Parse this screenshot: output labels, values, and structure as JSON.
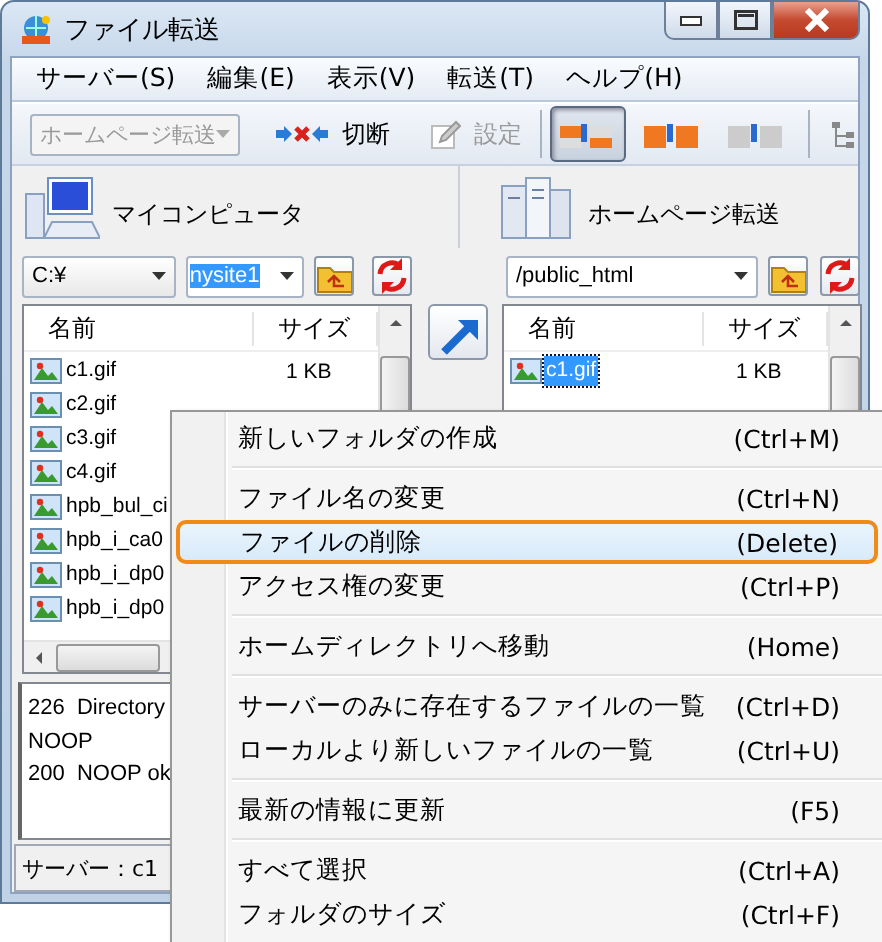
{
  "window": {
    "title": "ファイル転送"
  },
  "menu_bar": [
    {
      "label": "サーバー(S)"
    },
    {
      "label": "編集(E)"
    },
    {
      "label": "表示(V)"
    },
    {
      "label": "転送(T)"
    },
    {
      "label": "ヘルプ(H)"
    }
  ],
  "toolbar": {
    "site_select": {
      "value": "ホームページ転送",
      "disabled": true
    },
    "buttons": [
      {
        "kind": "disconnect",
        "label": "切断",
        "disabled": false
      },
      {
        "kind": "settings",
        "label": "設定",
        "disabled": true
      }
    ],
    "view_modes": [
      {
        "kind": "mixed",
        "selected": true
      },
      {
        "kind": "binary",
        "selected": false
      },
      {
        "kind": "text",
        "selected": false
      }
    ]
  },
  "local_pane": {
    "title": "マイコンピュータ",
    "drive": "C:¥",
    "folder": {
      "value": "nysite1",
      "selected": true
    },
    "columns": [
      "名前",
      "サイズ"
    ],
    "files": [
      {
        "name": "c1.gif",
        "size": "1 KB",
        "selected": false
      },
      {
        "name": "c2.gif",
        "selected": false
      },
      {
        "name": "c3.gif",
        "selected": false
      },
      {
        "name": "c4.gif",
        "selected": false
      },
      {
        "name": "hpb_bul_ci",
        "selected": false
      },
      {
        "name": "hpb_i_ca0",
        "selected": false
      },
      {
        "name": "hpb_i_dp0",
        "selected": false
      },
      {
        "name": "hpb_i_dp0",
        "selected": false
      }
    ]
  },
  "remote_pane": {
    "title": "ホームページ転送",
    "path": "/public_html",
    "columns": [
      "名前",
      "サイズ"
    ],
    "files": [
      {
        "name": "c1.gif",
        "size": "1 KB",
        "selected": true
      }
    ]
  },
  "log": [
    "226  Directory",
    "NOOP",
    "200  NOOP ok"
  ],
  "status_bar": "サーバー：c1",
  "context_menu": [
    {
      "kind": "item",
      "label": "新しいフォルダの作成",
      "shortcut": "(Ctrl+M)",
      "selected": false
    },
    {
      "kind": "separator"
    },
    {
      "kind": "item",
      "label": "ファイル名の変更",
      "shortcut": "(Ctrl+N)",
      "selected": false
    },
    {
      "kind": "item",
      "label": "ファイルの削除",
      "shortcut": "(Delete)",
      "selected": true
    },
    {
      "kind": "item",
      "label": "アクセス権の変更",
      "shortcut": "(Ctrl+P)",
      "selected": false
    },
    {
      "kind": "separator"
    },
    {
      "kind": "item",
      "label": "ホームディレクトリへ移動",
      "shortcut": "(Home)",
      "selected": false
    },
    {
      "kind": "separator"
    },
    {
      "kind": "item",
      "label": "サーバーのみに存在するファイルの一覧",
      "shortcut": "(Ctrl+D)",
      "selected": false
    },
    {
      "kind": "item",
      "label": "ローカルより新しいファイルの一覧",
      "shortcut": "(Ctrl+U)",
      "selected": false
    },
    {
      "kind": "separator"
    },
    {
      "kind": "item",
      "label": "最新の情報に更新",
      "shortcut": "(F5)",
      "selected": false
    },
    {
      "kind": "separator"
    },
    {
      "kind": "item",
      "label": "すべて選択",
      "shortcut": "(Ctrl+A)",
      "selected": false
    },
    {
      "kind": "item",
      "label": "フォルダのサイズ",
      "shortcut": "(Ctrl+F)",
      "selected": false
    }
  ]
}
